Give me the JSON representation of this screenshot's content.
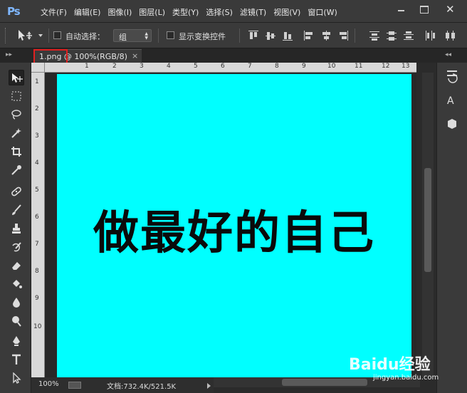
{
  "app": {
    "logo": "Ps"
  },
  "menu": [
    "文件(F)",
    "编辑(E)",
    "图像(I)",
    "图层(L)",
    "类型(Y)",
    "选择(S)",
    "滤镜(T)",
    "视图(V)",
    "窗口(W)"
  ],
  "window_controls": {
    "close": "✕"
  },
  "options_bar": {
    "auto_select_label": "自动选择：",
    "auto_select_value": "组",
    "show_transform_label": "显示变换控件"
  },
  "document": {
    "tab_title": "1.png @ 100%(RGB/8)",
    "tab_close": "×",
    "canvas_text": "做最好的自己",
    "canvas_color": "#00ffff"
  },
  "ruler": {
    "top": [
      "1",
      "2",
      "3",
      "4",
      "5",
      "6",
      "7",
      "8",
      "9",
      "10",
      "11",
      "12",
      "13"
    ],
    "left": [
      "1",
      "2",
      "3",
      "4",
      "5",
      "6",
      "7",
      "8",
      "9",
      "10"
    ]
  },
  "status": {
    "zoom": "100%",
    "doc_info": "文档:732.4K/521.5K"
  },
  "right_dock": {
    "letter": "A"
  },
  "watermark": {
    "logo": "Baidu经验",
    "url": "jingyan.baidu.com"
  },
  "colors": {
    "accent_highlight": "#e02020",
    "ps_logo": "#7fb7ff"
  }
}
